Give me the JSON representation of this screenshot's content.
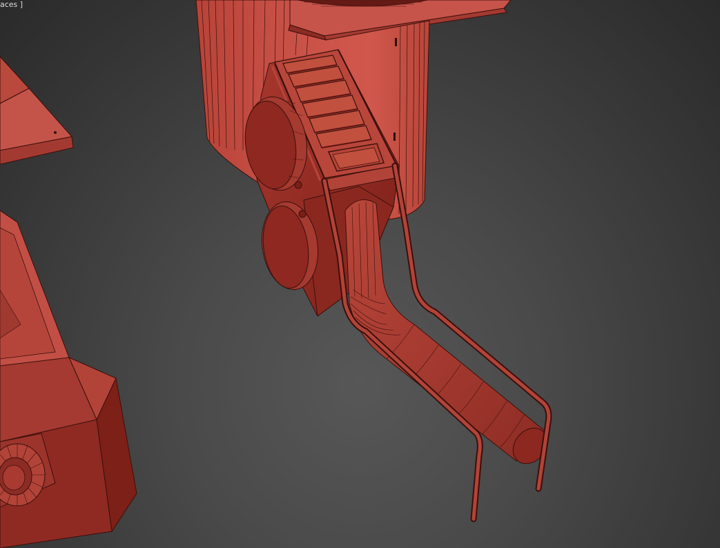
{
  "viewport": {
    "label_text": "aces ]",
    "model_color": "#c0463a",
    "model_shadow_color": "#7e1f19",
    "wire_color": "#3a0f0c",
    "background_color": "#4a4a4a"
  }
}
